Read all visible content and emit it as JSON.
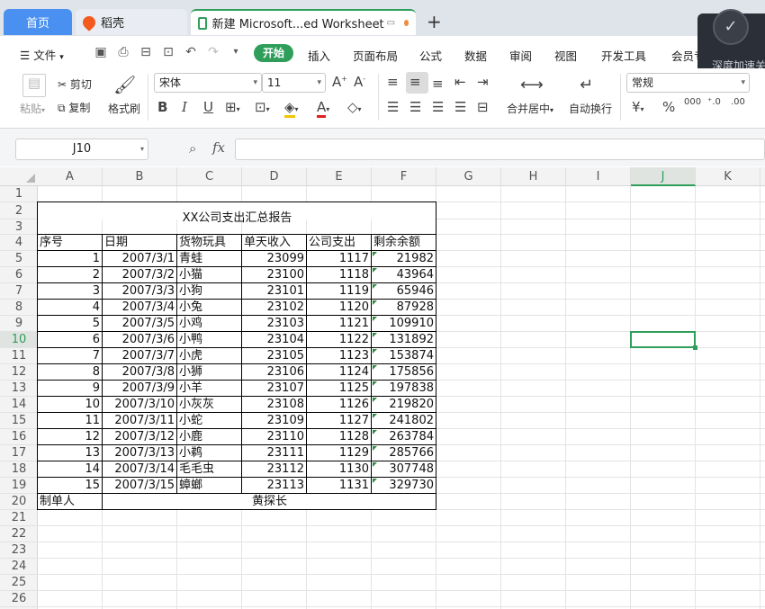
{
  "tabs": {
    "home": "首页",
    "daoke": "稻壳",
    "doc": "新建 Microsoft...ed Worksheet",
    "add": "+"
  },
  "popup": {
    "text": "深度加速关"
  },
  "menu": {
    "file": "文件",
    "start": "开始",
    "items": [
      "插入",
      "页面布局",
      "公式",
      "数据",
      "审阅",
      "视图",
      "开发工具",
      "会员专"
    ]
  },
  "ribbon": {
    "paste": "粘贴",
    "cut": "剪切",
    "copy": "复制",
    "format_painter": "格式刷",
    "font_name": "宋体",
    "font_size": "11",
    "merge_center": "合并居中",
    "wrap_text": "自动换行",
    "number_format": "常规",
    "currency": "¥",
    "percent": "%"
  },
  "formula_bar": {
    "name_box": "J10",
    "fx": "fx",
    "formula": ""
  },
  "columns": [
    "A",
    "B",
    "C",
    "D",
    "E",
    "F",
    "G",
    "H",
    "I",
    "J",
    "K"
  ],
  "active_cell": {
    "col": "J",
    "row": 10
  },
  "rows": [
    1,
    2,
    3,
    4,
    5,
    6,
    7,
    8,
    9,
    10,
    11,
    12,
    13,
    14,
    15,
    16,
    17,
    18,
    19,
    20,
    21,
    22,
    23,
    24,
    25,
    26
  ],
  "sheet": {
    "title": "XX公司支出汇总报告",
    "headers": [
      "序号",
      "日期",
      "货物玩具",
      "单天收入",
      "公司支出",
      "剩余余额"
    ],
    "data": [
      [
        "1",
        "2007/3/1",
        "青蛙",
        "23099",
        "1117",
        "21982"
      ],
      [
        "2",
        "2007/3/2",
        "小猫",
        "23100",
        "1118",
        "43964"
      ],
      [
        "3",
        "2007/3/3",
        "小狗",
        "23101",
        "1119",
        "65946"
      ],
      [
        "4",
        "2007/3/4",
        "小兔",
        "23102",
        "1120",
        "87928"
      ],
      [
        "5",
        "2007/3/5",
        "小鸡",
        "23103",
        "1121",
        "109910"
      ],
      [
        "6",
        "2007/3/6",
        "小鸭",
        "23104",
        "1122",
        "131892"
      ],
      [
        "7",
        "2007/3/7",
        "小虎",
        "23105",
        "1123",
        "153874"
      ],
      [
        "8",
        "2007/3/8",
        "小狮",
        "23106",
        "1124",
        "175856"
      ],
      [
        "9",
        "2007/3/9",
        "小羊",
        "23107",
        "1125",
        "197838"
      ],
      [
        "10",
        "2007/3/10",
        "小灰灰",
        "23108",
        "1126",
        "219820"
      ],
      [
        "11",
        "2007/3/11",
        "小蛇",
        "23109",
        "1127",
        "241802"
      ],
      [
        "12",
        "2007/3/12",
        "小鹿",
        "23110",
        "1128",
        "263784"
      ],
      [
        "13",
        "2007/3/13",
        "小鹈",
        "23111",
        "1129",
        "285766"
      ],
      [
        "14",
        "2007/3/14",
        "毛毛虫",
        "23112",
        "1130",
        "307748"
      ],
      [
        "15",
        "2007/3/15",
        "蟑螂",
        "23113",
        "1131",
        "329730"
      ]
    ],
    "footer_label": "制单人",
    "footer_value": "黄探长"
  },
  "colors": {
    "accent": "#2e9e5a",
    "tab_active": "#4a90f0"
  }
}
